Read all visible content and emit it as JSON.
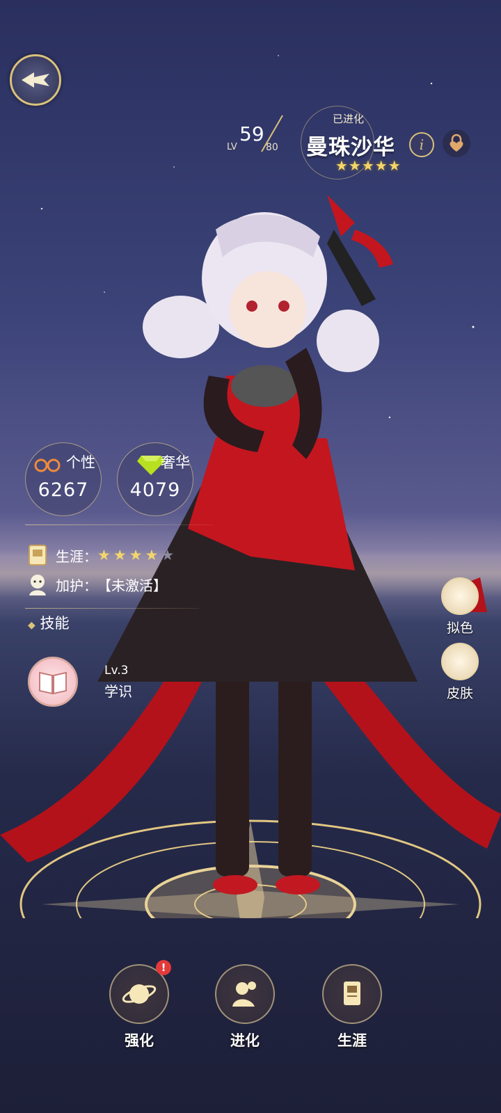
{
  "back_button": {
    "icon": "back-arrow-wing-icon"
  },
  "header": {
    "level_label": "LV",
    "level_value": "59",
    "level_max": "80",
    "evolved_status": "已进化",
    "character_name": "曼珠沙华",
    "rank_stars": "★★★★★",
    "info_icon": "info-icon",
    "lock_icon": "heart-lock-icon"
  },
  "stats": {
    "personality": {
      "label": "个性",
      "value": "6267",
      "icon": "personality-icon"
    },
    "luxury": {
      "label": "奢华",
      "value": "4079",
      "icon": "diamond-icon"
    }
  },
  "career": {
    "label": "生涯：",
    "stars_filled": "★★★★",
    "stars_empty": "★",
    "level": 4,
    "max": 5
  },
  "protection": {
    "label": "加护：",
    "value": "【未激活】"
  },
  "skills": {
    "title": "技能",
    "bullet": "◆",
    "lv": "Lv.3",
    "name": "学识"
  },
  "side_buttons": {
    "dye_label": "拟色",
    "skin_label": "皮肤"
  },
  "bottom_nav": {
    "enhance_label": "强化",
    "evolve_label": "进化",
    "career_label": "生涯",
    "alert": "!"
  },
  "colors": {
    "gold": "#d9c27a",
    "red": "#c0151e",
    "alert": "#e23a3a"
  }
}
